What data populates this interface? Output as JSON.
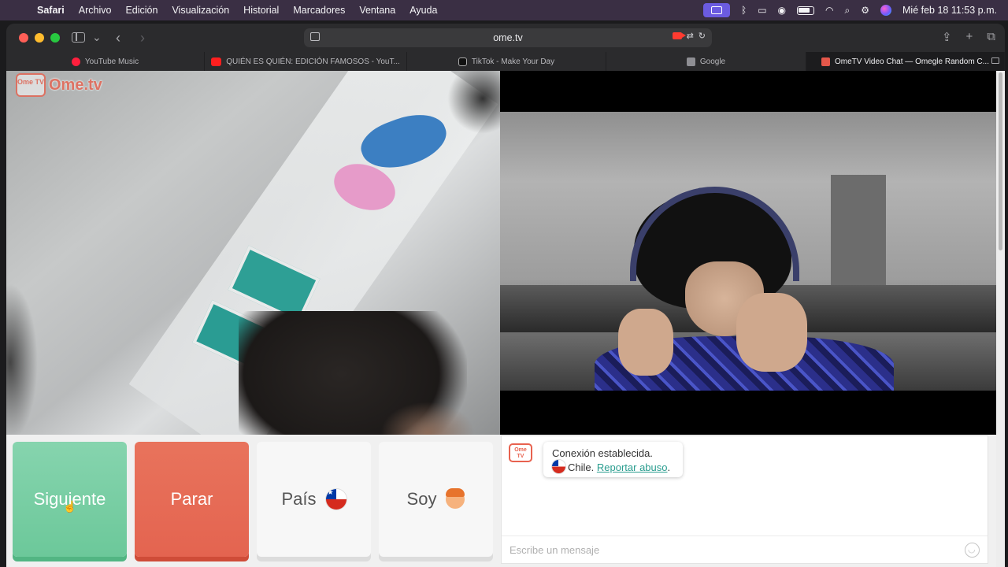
{
  "menubar": {
    "app": "Safari",
    "items": [
      "Archivo",
      "Edición",
      "Visualización",
      "Historial",
      "Marcadores",
      "Ventana",
      "Ayuda"
    ],
    "clock": "Mié feb 18  11:53 p.m."
  },
  "toolbar": {
    "url": "ome.tv"
  },
  "tabs": [
    {
      "label": "YouTube Music",
      "favicon": "youtube-music"
    },
    {
      "label": "QUIÉN ES QUIÉN: EDICIÓN FAMOSOS - YouT...",
      "favicon": "youtube"
    },
    {
      "label": "TikTok - Make Your Day",
      "favicon": "tiktok"
    },
    {
      "label": "Google",
      "favicon": "google"
    },
    {
      "label": "OmeTV Video Chat — Omegle Random C...",
      "favicon": "ometv",
      "active": true
    }
  ],
  "logo": {
    "badge": "Ome TV",
    "text": "Ome.tv"
  },
  "controls": {
    "next": "Siguiente",
    "stop": "Parar",
    "country": "País",
    "gender": "Soy"
  },
  "chat": {
    "avatar": "Ome TV",
    "status": "Conexión establecida.",
    "country": "Chile.",
    "report": "Reportar abuso",
    "report_suffix": ".",
    "placeholder": "Escribe un mensaje"
  },
  "colors": {
    "next_button": "#6cc89a",
    "stop_button": "#e46450",
    "brand": "#e8624f",
    "link": "#2a9d8f"
  }
}
